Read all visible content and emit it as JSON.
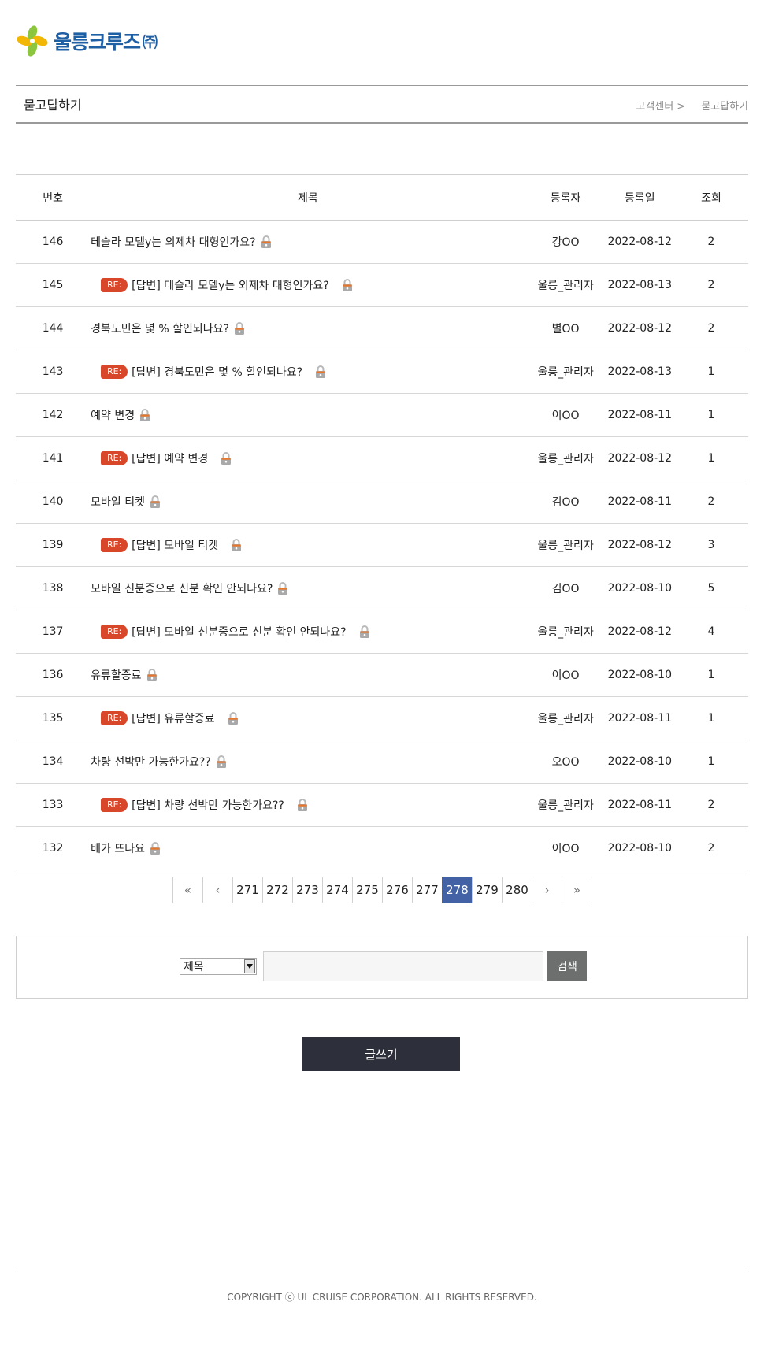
{
  "header": {
    "brand": "울릉크루즈",
    "corp": "㈜",
    "colors": {
      "brand_blue": "#1f5fa3",
      "logo_green": "#8cc63f",
      "logo_yellow": "#f2b705"
    }
  },
  "titlebar": {
    "title": "묻고답하기",
    "breadcrumb": [
      "고객센터 >",
      "묻고답하기"
    ]
  },
  "table": {
    "columns": [
      "번호",
      "제목",
      "등록자",
      "등록일",
      "조회"
    ],
    "reply_badge": "RE:",
    "rows": [
      {
        "num": "146",
        "subject": "테슬라 모델y는 외제차 대형인가요?",
        "writer": "강OO",
        "date": "2022-08-12",
        "views": "2",
        "reply": false
      },
      {
        "num": "145",
        "subject": "[답변] 테슬라 모델y는 외제차 대형인가요?",
        "writer": "울릉_관리자",
        "date": "2022-08-13",
        "views": "2",
        "reply": true
      },
      {
        "num": "144",
        "subject": "경북도민은 몇 % 할인되나요?",
        "writer": "별OO",
        "date": "2022-08-12",
        "views": "2",
        "reply": false
      },
      {
        "num": "143",
        "subject": "[답변] 경북도민은 몇 % 할인되나요?",
        "writer": "울릉_관리자",
        "date": "2022-08-13",
        "views": "1",
        "reply": true
      },
      {
        "num": "142",
        "subject": "예약 변경",
        "writer": "이OO",
        "date": "2022-08-11",
        "views": "1",
        "reply": false
      },
      {
        "num": "141",
        "subject": "[답변] 예약 변경",
        "writer": "울릉_관리자",
        "date": "2022-08-12",
        "views": "1",
        "reply": true
      },
      {
        "num": "140",
        "subject": "모바일 티켓",
        "writer": "김OO",
        "date": "2022-08-11",
        "views": "2",
        "reply": false
      },
      {
        "num": "139",
        "subject": "[답변] 모바일 티켓",
        "writer": "울릉_관리자",
        "date": "2022-08-12",
        "views": "3",
        "reply": true
      },
      {
        "num": "138",
        "subject": "모바일 신분증으로 신분 확인 안되나요?",
        "writer": "김OO",
        "date": "2022-08-10",
        "views": "5",
        "reply": false
      },
      {
        "num": "137",
        "subject": "[답변] 모바일 신분증으로 신분 확인 안되나요?",
        "writer": "울릉_관리자",
        "date": "2022-08-12",
        "views": "4",
        "reply": true
      },
      {
        "num": "136",
        "subject": "유류할증료",
        "writer": "이OO",
        "date": "2022-08-10",
        "views": "1",
        "reply": false
      },
      {
        "num": "135",
        "subject": "[답변] 유류할증료",
        "writer": "울릉_관리자",
        "date": "2022-08-11",
        "views": "1",
        "reply": true
      },
      {
        "num": "134",
        "subject": "차량 선박만 가능한가요??",
        "writer": "오OO",
        "date": "2022-08-10",
        "views": "1",
        "reply": false
      },
      {
        "num": "133",
        "subject": "[답변] 차량 선박만 가능한가요??",
        "writer": "울릉_관리자",
        "date": "2022-08-11",
        "views": "2",
        "reply": true
      },
      {
        "num": "132",
        "subject": "배가 뜨나요",
        "writer": "이OO",
        "date": "2022-08-10",
        "views": "2",
        "reply": false
      }
    ]
  },
  "pagination": {
    "first": "«",
    "prev": "‹",
    "pages": [
      "271",
      "272",
      "273",
      "274",
      "275",
      "276",
      "277",
      "278",
      "279",
      "280"
    ],
    "current": "278",
    "next": "›",
    "last": "»"
  },
  "search": {
    "field_selected": "제목",
    "input_value": "",
    "button_label": "검색"
  },
  "write_button": "글쓰기",
  "footer": {
    "copyright": "COPYRIGHT ⓒ UL CRUISE CORPORATION. ALL RIGHTS RESERVED."
  },
  "icons": {
    "lock": "lock-icon",
    "logo": "clover-logo-icon",
    "dropdown": "dropdown-arrow-icon"
  },
  "colors": {
    "reply_badge": "#d9472b",
    "pager_active": "#4262a5",
    "search_button": "#6d6f6f",
    "write_button": "#2d2f3a"
  }
}
